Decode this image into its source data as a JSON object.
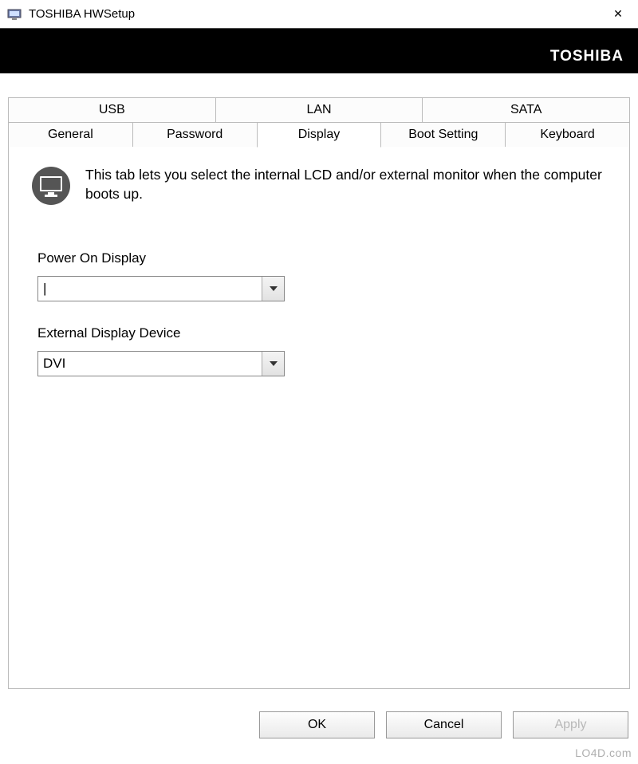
{
  "window": {
    "title": "TOSHIBA HWSetup",
    "close_symbol": "✕"
  },
  "brand": "TOSHIBA",
  "tabs": {
    "top": [
      "USB",
      "LAN",
      "SATA"
    ],
    "bottom": [
      "General",
      "Password",
      "Display",
      "Boot Setting",
      "Keyboard"
    ],
    "active": "Display"
  },
  "display_tab": {
    "description": "This tab lets you select the internal LCD and/or external monitor when the computer boots up.",
    "power_on_label": "Power On Display",
    "power_on_value": "|",
    "external_label": "External Display Device",
    "external_value": "DVI"
  },
  "buttons": {
    "ok": "OK",
    "cancel": "Cancel",
    "apply": "Apply"
  },
  "watermark": "LO4D.com",
  "icons": {
    "app_icon": "toshiba-setup-icon",
    "monitor": "monitor-icon",
    "dropdown": "chevron-down-icon",
    "close": "close-icon"
  }
}
